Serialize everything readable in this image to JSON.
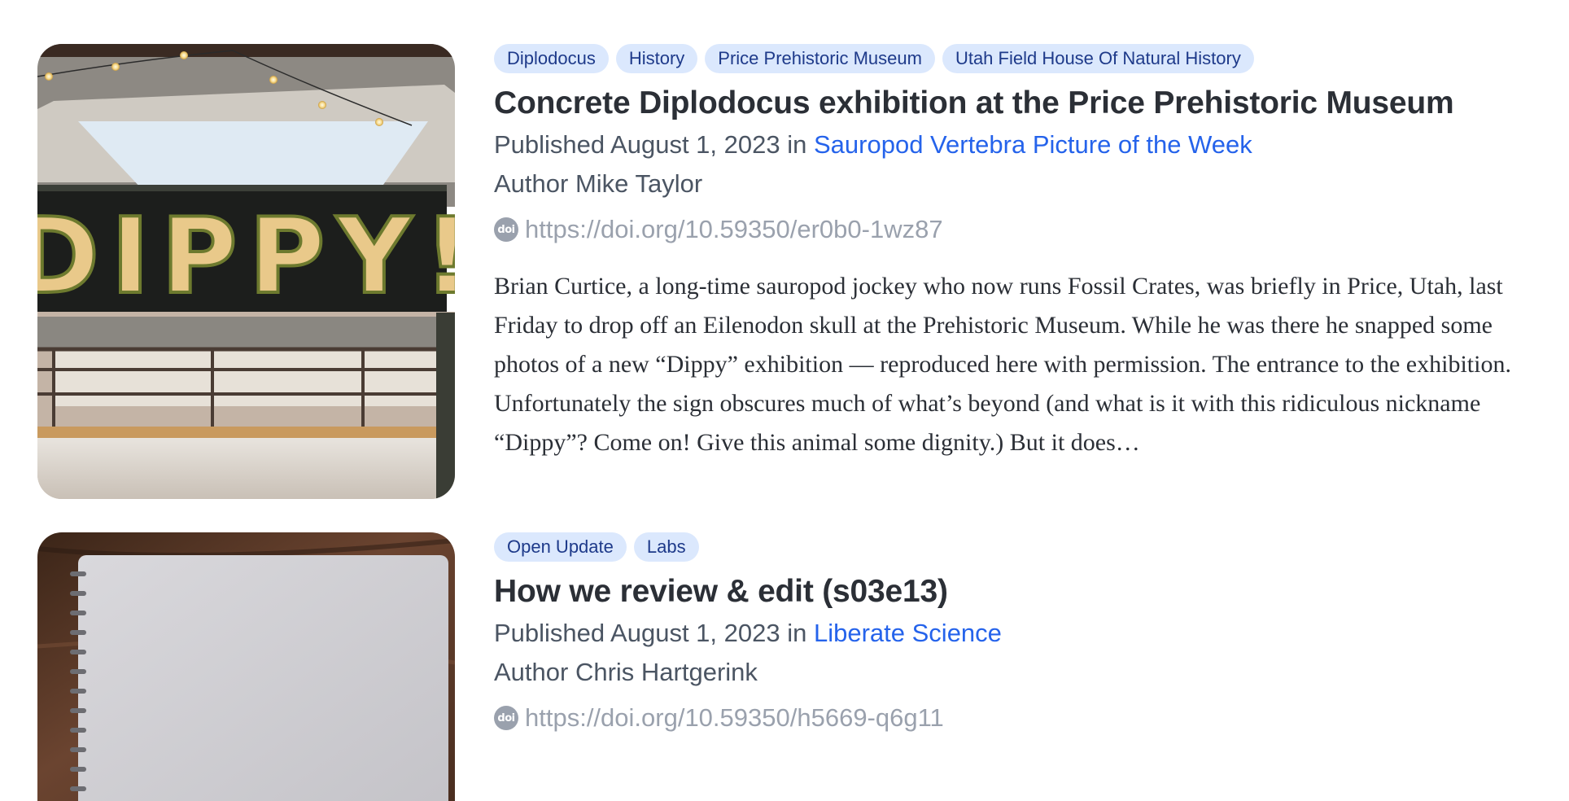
{
  "posts": [
    {
      "tags": [
        "Diplodocus",
        "History",
        "Price Prehistoric Museum",
        "Utah Field House Of Natural History"
      ],
      "title": "Concrete Diplodocus exhibition at the Price Prehistoric Museum",
      "published_prefix": "Published August 1, 2023 in",
      "blog_name": "Sauropod Vertebra Picture of the Week",
      "author_line": "Author Mike Taylor",
      "doi_label": "doi",
      "doi_url": "https://doi.org/10.59350/er0b0-1wz87",
      "summary": "Brian Curtice, a long-time sauropod jockey who now runs Fossil Crates, was briefly in Price, Utah, last Friday to drop off an Eilenodon skull at the Prehistoric Museum. While he was there he snapped some photos of a new “Dippy” exhibition — reproduced here with permission. The entrance to the exhibition. Unfortunately the sign obscures much of what’s beyond (and what is it with this ridiculous nickname “Dippy”? Come on! Give this animal some dignity.) But it does…",
      "image_sign_text": "DIPPY!"
    },
    {
      "tags": [
        "Open Update",
        "Labs"
      ],
      "title": "How we review & edit (s03e13)",
      "published_prefix": "Published August 1, 2023 in",
      "blog_name": "Liberate Science",
      "author_line": "Author Chris Hartgerink",
      "doi_label": "doi",
      "doi_url": "https://doi.org/10.59350/h5669-q6g11"
    }
  ],
  "colors": {
    "tag_bg": "#dbe8fd",
    "tag_text": "#1e3a8a",
    "link_blue": "#2563eb",
    "muted_gray": "#9aa1ad",
    "title_text": "#2b2f36",
    "meta_text": "#4b5563"
  }
}
